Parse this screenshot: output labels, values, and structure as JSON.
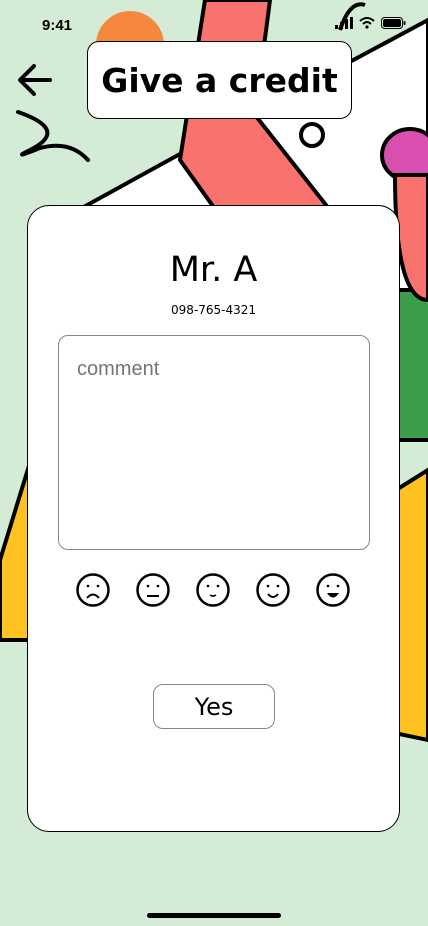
{
  "status_bar": {
    "time": "9:41",
    "icons": [
      "signal-icon",
      "wifi-icon",
      "battery-icon"
    ]
  },
  "header": {
    "title": "Give a credit",
    "back_icon": "arrow-left-icon"
  },
  "person": {
    "name": "Mr. A",
    "phone": "098-765-4321"
  },
  "comment": {
    "placeholder": "comment",
    "value": ""
  },
  "rating": {
    "faces": [
      "sad-face-icon",
      "neutral-face-icon",
      "slight-smile-face-icon",
      "smile-face-icon",
      "happy-face-icon"
    ],
    "selected": null
  },
  "actions": {
    "confirm_label": "Yes"
  },
  "colors": {
    "background": "#d4ebd6",
    "coral": "#f8736e",
    "yellow": "#ffc221",
    "green": "#3a9e4a",
    "orange": "#f6883e",
    "pink": "#d94faf"
  }
}
